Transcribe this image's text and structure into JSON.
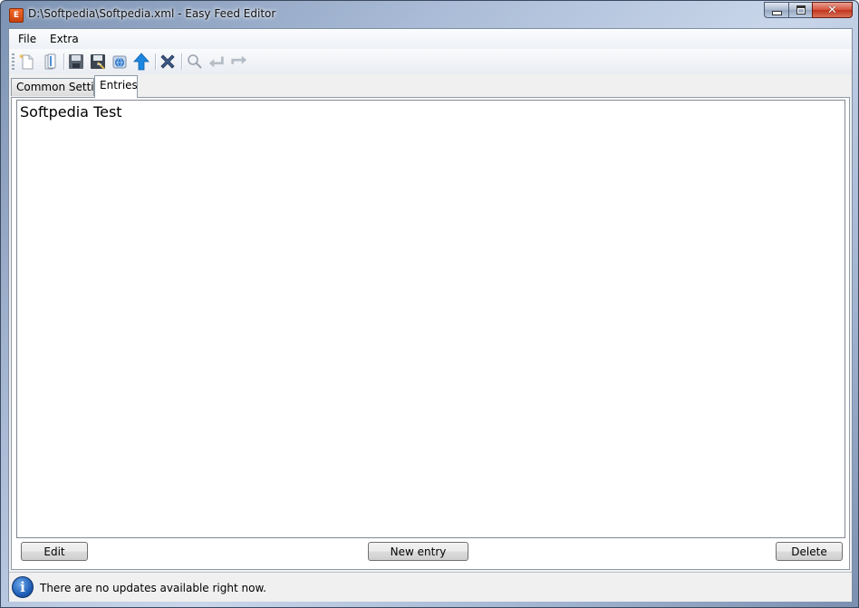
{
  "window": {
    "title": "D:\\Softpedia\\Softpedia.xml - Easy Feed Editor",
    "app_icon_glyph": "E"
  },
  "menu": {
    "items": [
      {
        "label": "File"
      },
      {
        "label": "Extra"
      }
    ]
  },
  "toolbar": {
    "icons": [
      "new-file-icon",
      "open-icon",
      "save-icon",
      "save-as-icon",
      "publish-globe-icon",
      "upload-icon",
      "delete-icon",
      "find-icon",
      "undo-icon",
      "redo-icon"
    ]
  },
  "tabs": [
    {
      "label": "Common Settings",
      "active": false
    },
    {
      "label": "Entries",
      "active": true
    }
  ],
  "entries": {
    "items": [
      "Softpedia Test"
    ]
  },
  "buttons": {
    "edit_label": "Edit",
    "new_entry_label": "New entry",
    "delete_label": "Delete"
  },
  "status": {
    "icon": "info-icon",
    "info_glyph": "i",
    "message": "There are no updates available right now."
  },
  "colors": {
    "accent_blue": "#1f5fb8",
    "close_red": "#c2341c",
    "app_icon_orange": "#e8581a"
  }
}
